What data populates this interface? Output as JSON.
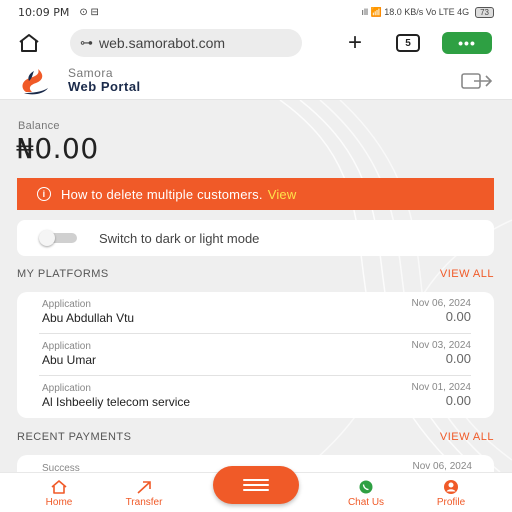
{
  "statusbar": {
    "time": "10:09 PM",
    "icons_left": "⊙ ⊟",
    "signal": "ıll 📶 18.0 KB/s Vo LTE 4G",
    "battery": "73"
  },
  "browser": {
    "url": "web.samorabot.com",
    "tab_count": "5",
    "menu_label": "•••"
  },
  "header": {
    "brand_line1": "Samora",
    "brand_line2": "Web Portal"
  },
  "balance": {
    "label": "Balance",
    "value": "₦0.00"
  },
  "alert": {
    "text": "How to delete multiple customers.",
    "link": "View"
  },
  "theme_toggle": {
    "label": "Switch to dark or light mode"
  },
  "platforms": {
    "title": "MY PLATFORMS",
    "view_all": "VIEW ALL",
    "items": [
      {
        "kind": "Application",
        "name": "Abu Abdullah Vtu",
        "date": "Nov 06, 2024",
        "amount": "0.00"
      },
      {
        "kind": "Application",
        "name": "Abu Umar",
        "date": "Nov 03, 2024",
        "amount": "0.00"
      },
      {
        "kind": "Application",
        "name": "Al Ishbeeliy telecom service",
        "date": "Nov 01, 2024",
        "amount": "0.00"
      }
    ]
  },
  "payments": {
    "title": "RECENT PAYMENTS",
    "view_all": "VIEW ALL",
    "items": [
      {
        "status": "Success",
        "date": "Nov 06, 2024"
      }
    ]
  },
  "nav": {
    "home": "Home",
    "transfer": "Transfer",
    "chat": "Chat Us",
    "profile": "Profile"
  },
  "colors": {
    "accent": "#f05a28",
    "menu_green": "#2ea043",
    "link_yellow": "#ffe24a",
    "brand_navy": "#1a2a4a"
  }
}
